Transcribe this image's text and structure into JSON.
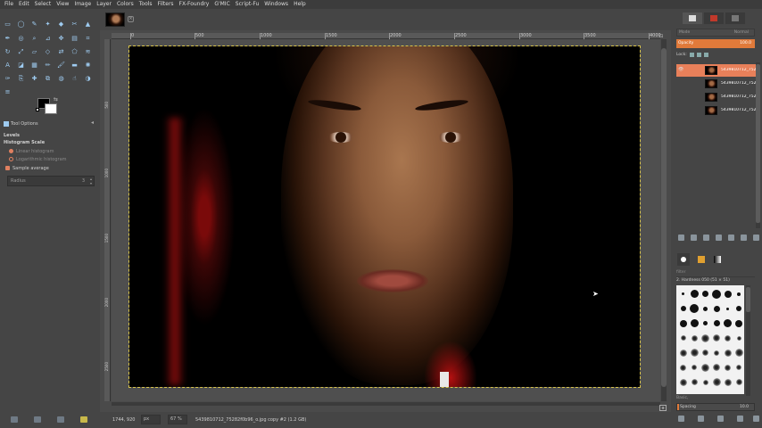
{
  "menu": [
    "File",
    "Edit",
    "Select",
    "View",
    "Image",
    "Layer",
    "Colors",
    "Tools",
    "Filters",
    "FX-Foundry",
    "G'MIC",
    "Script-Fu",
    "Windows",
    "Help"
  ],
  "tool_options": {
    "header": "Tool Options",
    "section_title": "Levels",
    "histogram_scale_label": "Histogram Scale",
    "linear_label": "Linear histogram",
    "log_label": "Logarithmic histogram",
    "sample_average_label": "Sample average",
    "radius_label": "Radius",
    "radius_value": "3"
  },
  "ruler": {
    "top_ticks": [
      "0",
      "500",
      "1000",
      "1500",
      "2000",
      "2500",
      "3000",
      "3500",
      "4000"
    ],
    "left_ticks": [
      "500",
      "1000",
      "1500",
      "2000",
      "2500"
    ]
  },
  "status": {
    "coords": "1744, 920",
    "unit": "px",
    "zoom": "67 %",
    "file_label": "5439810712_75282f0b96_o.jpg copy #2 (1.2 GB)"
  },
  "layers_panel": {
    "mode_label": "Mode",
    "mode_value": "Normal",
    "opacity_label": "Opacity",
    "opacity_value": "100.0",
    "lock_label": "Lock:",
    "layers": [
      {
        "name": "5439810712_75282f0b96_o.jpg",
        "selected": true
      },
      {
        "name": "5439810712_75282f0b96_o.jpg",
        "selected": false
      },
      {
        "name": "5439810712_75282f0b96_o.jpg",
        "selected": false
      },
      {
        "name": "5439810712_75282f0b96_o.jpg",
        "selected": false
      }
    ]
  },
  "brushes_panel": {
    "filter_placeholder": "filter",
    "brush_name": "2. Hardness 050 (51 × 51)",
    "tag_placeholder": "Basic,",
    "spacing_label": "Spacing",
    "spacing_value": "10.0"
  },
  "colors": {
    "accent": "#e07a3a",
    "selected_layer": "#e8805a",
    "background": "#454545"
  }
}
